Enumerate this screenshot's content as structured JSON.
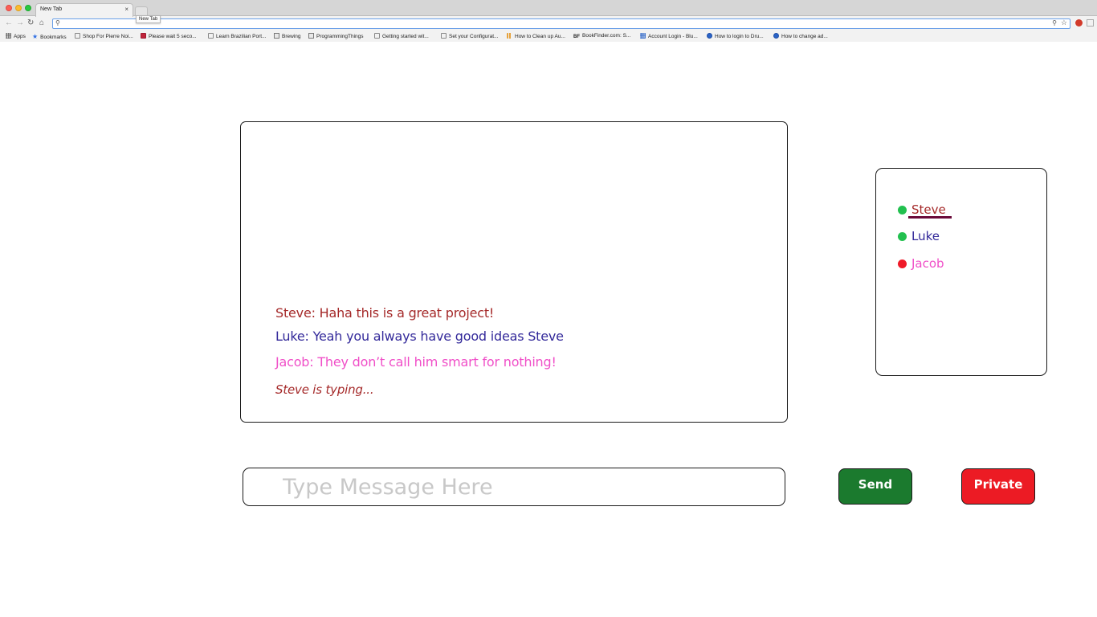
{
  "browser": {
    "tab_title": "New Tab",
    "tab_close": "×",
    "tooltip": "New Tab",
    "address_value": "",
    "bookmarks": [
      {
        "label": "Apps",
        "icon": "apps-grid-icon"
      },
      {
        "label": "Bookmarks",
        "icon": "star-icon"
      },
      {
        "label": "Shop For Pierre Noi...",
        "icon": "page-icon"
      },
      {
        "label": "Please wait 5 seco...",
        "icon": "red-square-icon"
      },
      {
        "label": "Learn Brazilian Port...",
        "icon": "page-icon"
      },
      {
        "label": "Brewing",
        "icon": "folder-icon"
      },
      {
        "label": "ProgrammingThings",
        "icon": "folder-icon"
      },
      {
        "label": "Getting started wit...",
        "icon": "page-icon"
      },
      {
        "label": "Set your Configurat...",
        "icon": "page-icon"
      },
      {
        "label": "How to Clean up Au...",
        "icon": "bars-icon"
      },
      {
        "label": "BookFinder.com: S...",
        "icon": "bf-logo-icon"
      },
      {
        "label": "Account Login - Blu...",
        "icon": "grid-icon"
      },
      {
        "label": "How to login to Dru...",
        "icon": "drupal-icon"
      },
      {
        "label": "How to change ad...",
        "icon": "drupal-icon"
      }
    ]
  },
  "chat": {
    "messages": [
      {
        "text": "Steve: Haha this is a great project!",
        "color": "#a52a2a"
      },
      {
        "text": "Luke: Yeah you always have good ideas Steve",
        "color": "#33299a"
      },
      {
        "text": "Jacob: They don’t call him smart for nothing!",
        "color": "#f04fc8"
      }
    ],
    "typing_indicator": "Steve is typing...",
    "typing_color": "#a52a2a"
  },
  "users": [
    {
      "name": "Steve",
      "status": "online",
      "status_color": "#22c04f",
      "name_color": "#a52a2a",
      "selected": true,
      "underline_color": "#6b0a3a"
    },
    {
      "name": "Luke",
      "status": "online",
      "status_color": "#22c04f",
      "name_color": "#33299a",
      "selected": false
    },
    {
      "name": "Jacob",
      "status": "offline",
      "status_color": "#ef1a28",
      "name_color": "#f04fc8",
      "selected": false
    }
  ],
  "composer": {
    "placeholder": "Type Message Here",
    "value": ""
  },
  "buttons": {
    "send_label": "Send",
    "send_color": "#1b7a2e",
    "private_label": "Private",
    "private_color": "#ec1b24"
  }
}
